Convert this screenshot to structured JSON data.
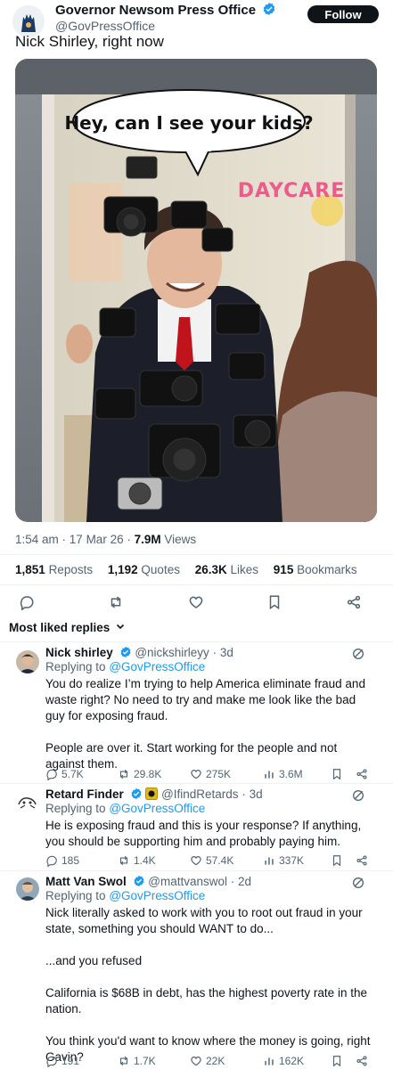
{
  "post": {
    "author_name": "Governor Newsom Press Office",
    "author_handle": "@GovPressOffice",
    "follow_label": "Follow",
    "text": "Nick Shirley, right now",
    "image": {
      "speech_bubble": "Hey, can I see your kids?",
      "sign": "DAYCARE"
    },
    "time": "1:54 am",
    "date": "17 Mar 26",
    "views_count": "7.9M",
    "views_label": "Views",
    "reposts_count": "1,851",
    "reposts_label": "Reposts",
    "quotes_count": "1,192",
    "quotes_label": "Quotes",
    "likes_count": "26.3K",
    "likes_label": "Likes",
    "bookmarks_count": "915",
    "bookmarks_label": "Bookmarks"
  },
  "replies_sort": "Most liked replies",
  "replies": [
    {
      "name": "Nick shirley",
      "handle": "@nickshirleyy",
      "age": "3d",
      "replying_prefix": "Replying to",
      "replying_to": "@GovPressOffice",
      "paragraphs": [
        "You do realize I’m trying to help America eliminate fraud and waste right? No need to try and make me look like the bad guy for exposing fraud.",
        "People are over it. Start working for the people and not against them."
      ],
      "replies": "5.7K",
      "reposts": "29.8K",
      "likes": "275K",
      "views": "3.6M"
    },
    {
      "name": "Retard Finder",
      "handle": "@IfindRetards",
      "age": "3d",
      "replying_prefix": "Replying to",
      "replying_to": "@GovPressOffice",
      "paragraphs": [
        "He is exposing fraud and this is your response? If anything, you should be supporting him and probably paying him."
      ],
      "replies": "185",
      "reposts": "1.4K",
      "likes": "57.4K",
      "views": "337K"
    },
    {
      "name": "Matt Van Swol",
      "handle": "@mattvanswol",
      "age": "2d",
      "replying_prefix": "Replying to",
      "replying_to": "@GovPressOffice",
      "paragraphs": [
        "Nick literally asked to work with you to root out fraud in your state, something you should WANT to do...",
        "...and you refused",
        "California is $68B in debt, has the highest poverty rate in the nation.",
        "You think you'd want to know where the money is going, right Gavin?"
      ],
      "replies": "191",
      "reposts": "1.7K",
      "likes": "22K",
      "views": "162K"
    }
  ],
  "colors": {
    "accent": "#1d9bf0",
    "text": "#0f1419",
    "secondary": "#536471",
    "gold_badge": "#e2b719"
  }
}
